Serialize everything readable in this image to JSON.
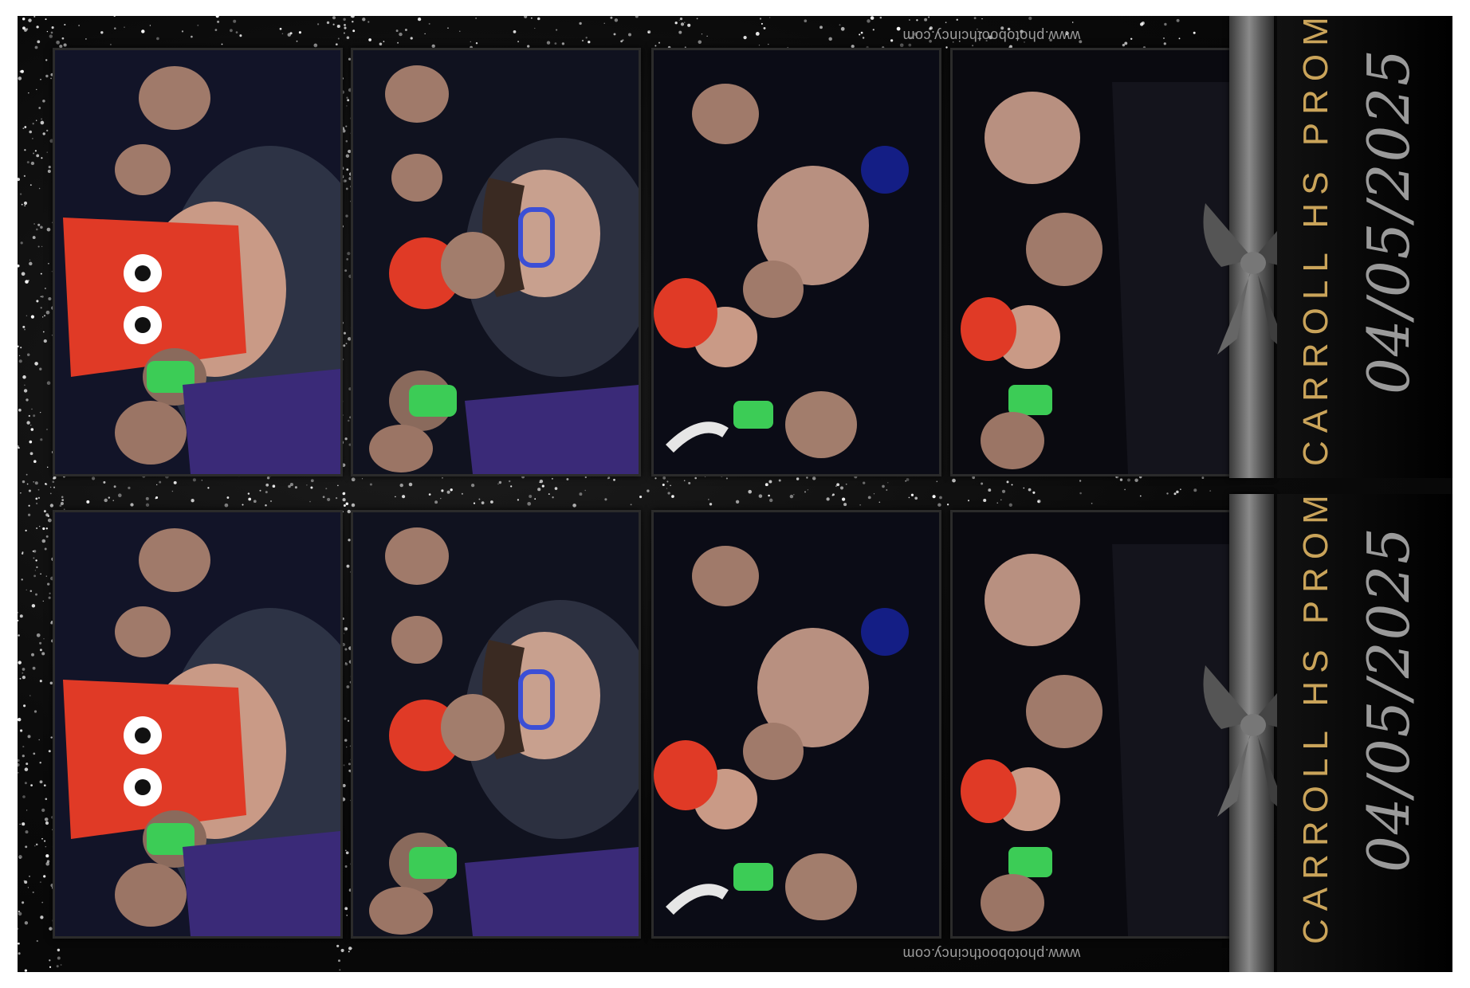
{
  "event": {
    "title": "CARROLL HS PROM",
    "date": "04/05/2025",
    "website": "www.photoboothcincy.com"
  },
  "strips": [
    {
      "id": "strip-1",
      "photos": 4
    },
    {
      "id": "strip-2",
      "photos": 4
    }
  ],
  "colors": {
    "background": "#0a0a0a",
    "title_gold": "#caa45a",
    "date_gray": "#9a9a9a",
    "ribbon_silver": "#8a8a8a"
  }
}
